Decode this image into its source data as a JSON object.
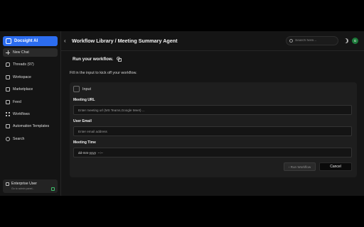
{
  "brand": {
    "name": "Docsight AI",
    "icon": "docsight-logo-icon"
  },
  "sidebar": {
    "items": [
      {
        "label": "New Chat",
        "icon": "plus-icon"
      },
      {
        "label": "Threads (97)",
        "icon": "chat-icon"
      },
      {
        "label": "Workspace",
        "icon": "workspace-icon"
      },
      {
        "label": "Marketplace",
        "icon": "marketplace-icon"
      },
      {
        "label": "Feed",
        "icon": "feed-icon"
      },
      {
        "label": "Workflows",
        "icon": "workflows-icon"
      },
      {
        "label": "Automation Templates",
        "icon": "templates-icon"
      },
      {
        "label": "Search",
        "icon": "search-icon"
      }
    ],
    "enterprise": {
      "title": "Enterprise User",
      "subtitle": "Go to admin panel..."
    }
  },
  "header": {
    "breadcrumb": "Workflow Library / Meeting Summary Agent",
    "search_placeholder": "Search here...",
    "avatar_initial": "G"
  },
  "main": {
    "run_title": "Run your workflow.",
    "subtitle": "Fill in the input to kick off your workflow.",
    "input_card": {
      "title": "Input",
      "fields": [
        {
          "label": "Meeting URL",
          "placeholder": "Enter meeting url (MS Teams,Google Meet) ..."
        },
        {
          "label": "User Email",
          "placeholder": "Enter email address"
        },
        {
          "label": "Meeting Time",
          "value": "dd-mm-yyyy  --:--"
        }
      ],
      "run_label": "› Run Workflow",
      "cancel_label": "Cancel"
    }
  },
  "colors": {
    "accent": "#2c6df0",
    "avatar": "#1c7a3a",
    "background": "#151515"
  }
}
